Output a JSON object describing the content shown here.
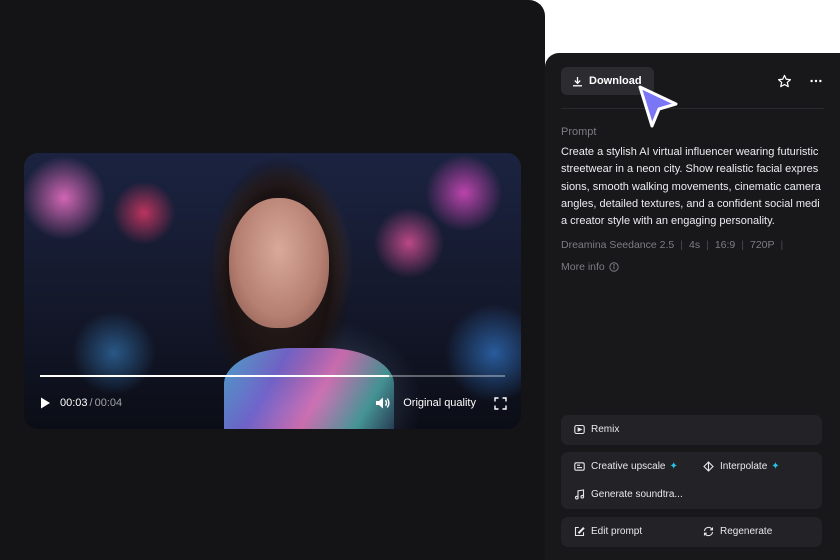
{
  "player": {
    "time_current": "00:03",
    "time_separator": "/",
    "time_total": "00:04",
    "quality": "Original quality",
    "progress": 0.75
  },
  "toolbar": {
    "download_label": "Download",
    "favorite_icon": "star-icon",
    "more_icon": "more-horizontal-icon"
  },
  "details": {
    "prompt_label": "Prompt",
    "prompt_text": "Create a stylish AI virtual influencer wearing futuristic streetwear in a neon city. Show realistic facial expressions, smooth walking movements, cinematic camera angles, detailed textures, and a confident social media creator style with an engaging personality.",
    "meta": [
      "Dreamina Seedance 2.5",
      "4s",
      "16:9",
      "720P"
    ],
    "more_info": "More info"
  },
  "actions": {
    "remix": "Remix",
    "creative_upscale": "Creative upscale",
    "interpolate": "Interpolate",
    "generate_soundtrack": "Generate soundtra...",
    "edit_prompt": "Edit prompt",
    "regenerate": "Regenerate"
  },
  "colors": {
    "accent_cursor": "#7b76f5",
    "spark": "#27c4e8",
    "panel": "#18181b",
    "card": "#232327"
  }
}
